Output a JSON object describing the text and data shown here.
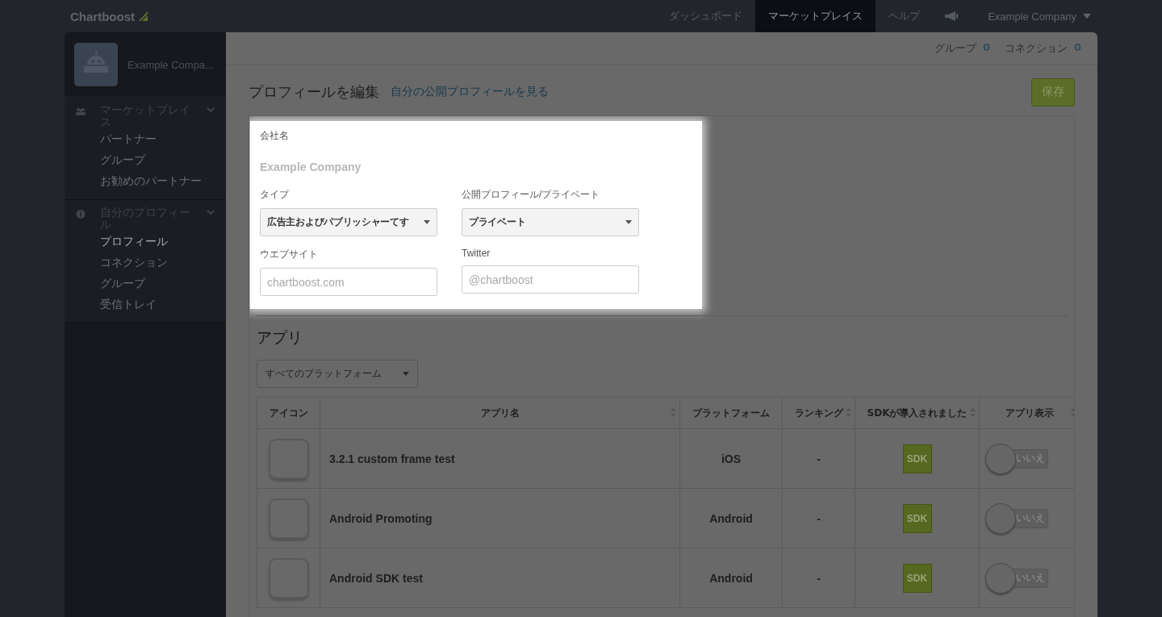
{
  "brand": "Chartboost",
  "nav": [
    {
      "label": "ダッシュボード",
      "selected": false
    },
    {
      "label": "マーケットプレイス",
      "selected": true
    },
    {
      "label": "ヘルプ",
      "selected": false
    }
  ],
  "account": "Example Company",
  "sidebar": {
    "name": "Example Compa...",
    "sections": [
      {
        "title": "マーケットプレイス",
        "items": [
          {
            "label": "パートナー",
            "selected": false
          },
          {
            "label": "グループ",
            "selected": false
          },
          {
            "label": "お勧めのパートナー",
            "selected": false
          }
        ]
      },
      {
        "title": "自分のプロフィール",
        "items": [
          {
            "label": "プロフィール",
            "selected": true
          },
          {
            "label": "コネクション",
            "selected": false
          },
          {
            "label": "グループ",
            "selected": false
          },
          {
            "label": "受信トレイ",
            "selected": false
          }
        ]
      }
    ]
  },
  "counts": [
    {
      "label": "グループ",
      "value": "0"
    },
    {
      "label": "コネクション",
      "value": "0"
    }
  ],
  "title": "プロフィールを編集",
  "public_link": "自分の公開プロフィールを見る",
  "save": "保存",
  "form": {
    "company_label": "会社名",
    "company": "Example Company",
    "fields": [
      {
        "kind": "select",
        "label": "タイプ",
        "value": "広告主およびパブリッシャーてす"
      },
      {
        "kind": "select",
        "label": "公開プロフィール/プライベート",
        "value": "プライベート"
      },
      {
        "kind": "input",
        "label": "ウエブサイト",
        "placeholder": "chartboost.com"
      },
      {
        "kind": "input",
        "label": "Twitter",
        "placeholder": "@chartboost"
      }
    ]
  },
  "apps": {
    "title": "アプリ",
    "filter": "すべてのプラットフォーム",
    "columns": [
      {
        "label": "アイコン",
        "sortable": false
      },
      {
        "label": "アプリ名",
        "sortable": true
      },
      {
        "label": "プラットフォーム",
        "sortable": false
      },
      {
        "label": "ランキング",
        "sortable": true
      },
      {
        "label": "SDKが導入されました",
        "sortable": true
      },
      {
        "label": "アプリ表示",
        "sortable": true
      }
    ],
    "rows": [
      {
        "name": "3.2.1 custom frame test",
        "platform": "iOS",
        "ranking": "-",
        "sdk": "SDK",
        "visible": {
          "on": false,
          "label": "いいえ"
        }
      },
      {
        "name": "Android Promoting",
        "platform": "Android",
        "ranking": "-",
        "sdk": "SDK",
        "visible": {
          "on": false,
          "label": "いいえ"
        }
      },
      {
        "name": "Android SDK test",
        "platform": "Android",
        "ranking": "-",
        "sdk": "SDK",
        "visible": {
          "on": false,
          "label": "いいえ"
        }
      }
    ]
  }
}
